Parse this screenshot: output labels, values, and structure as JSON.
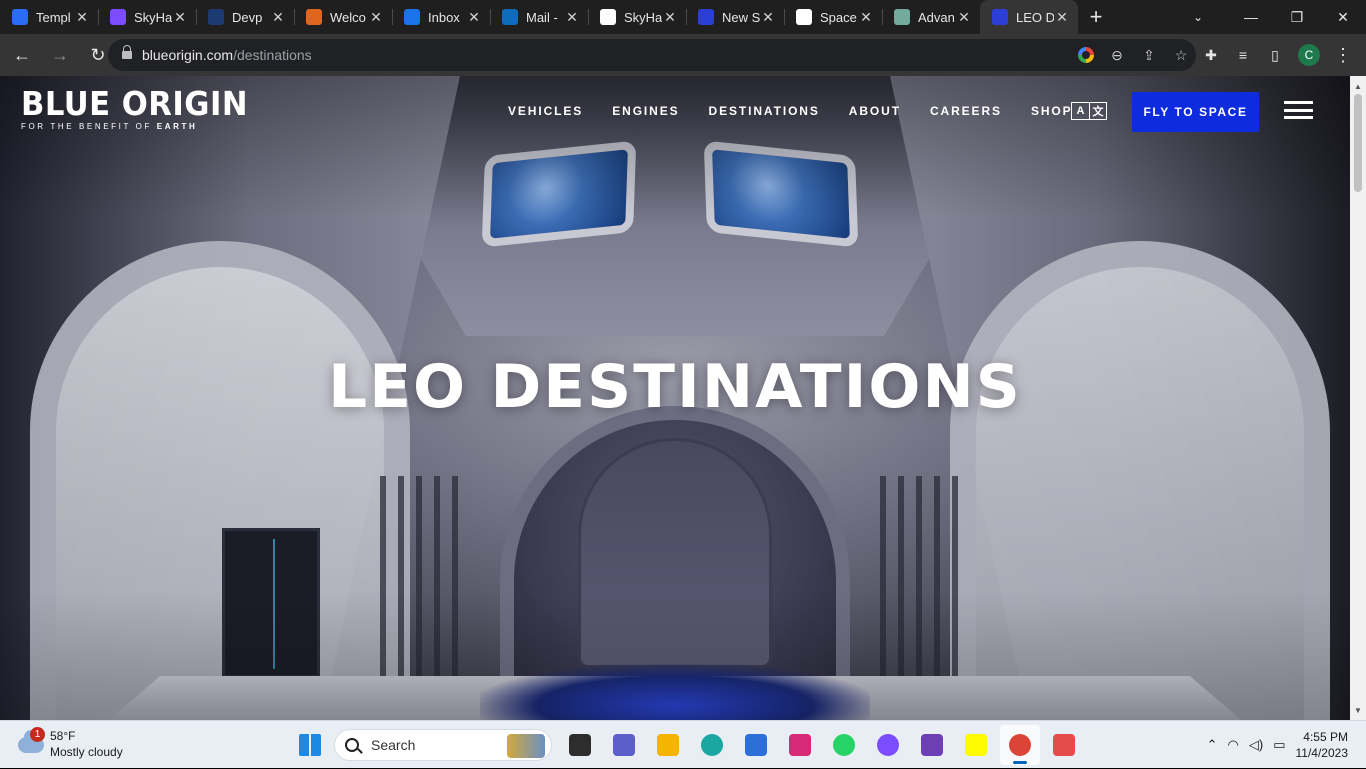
{
  "browser": {
    "tabs": [
      {
        "title": "Templ",
        "icon": "c-logo-icon",
        "color": "#2b6cf6"
      },
      {
        "title": "SkyHa",
        "icon": "shield-logo-icon",
        "color": "#7c4dff"
      },
      {
        "title": "Devp",
        "icon": "d-logo-icon",
        "color": "#1d3b73"
      },
      {
        "title": "Welco",
        "icon": "sunrise-icon",
        "color": "#e0651d"
      },
      {
        "title": "Inbox",
        "icon": "gear-logo-icon",
        "color": "#1a73e8"
      },
      {
        "title": "Mail -",
        "icon": "outlook-icon",
        "color": "#0f6cbd"
      },
      {
        "title": "SkyHa",
        "icon": "page-icon",
        "color": "#ffffff"
      },
      {
        "title": "New S",
        "icon": "feather-icon",
        "color": "#2b3fd6"
      },
      {
        "title": "Space",
        "icon": "x-logo-icon",
        "color": "#ffffff"
      },
      {
        "title": "Advan",
        "icon": "openai-icon",
        "color": "#74aa9c"
      },
      {
        "title": "LEO D",
        "icon": "feather-icon",
        "color": "#2b3fd6",
        "active": true
      }
    ],
    "url_host": "blueorigin.com",
    "url_path": "/destinations"
  },
  "site": {
    "logo": "BLUE ORIGIN",
    "tagline_prefix": "FOR THE BENEFIT OF ",
    "tagline_bold": "EARTH",
    "nav": [
      "VEHICLES",
      "ENGINES",
      "DESTINATIONS",
      "ABOUT",
      "CAREERS",
      "SHOP"
    ],
    "lang_a": "A",
    "lang_b": "文",
    "cta": "FLY TO SPACE",
    "hero_title": "LEO DESTINATIONS"
  },
  "taskbar": {
    "weather_badge": "1",
    "temp": "58°F",
    "condition": "Mostly cloudy",
    "search": "Search",
    "time": "4:55 PM",
    "date": "11/4/2023",
    "apps": [
      {
        "name": "start-icon",
        "color": "#1e88e5"
      },
      {
        "name": "file-explorer-dark-icon",
        "color": "#2d2d2d"
      },
      {
        "name": "teams-icon",
        "color": "#5b5fc7"
      },
      {
        "name": "folder-icon",
        "color": "#f4b400"
      },
      {
        "name": "edge-icon",
        "color": "#1ba7a1"
      },
      {
        "name": "store-icon",
        "color": "#2d6fd8"
      },
      {
        "name": "instagram-icon",
        "color": "#d62976"
      },
      {
        "name": "whatsapp-icon",
        "color": "#25d366"
      },
      {
        "name": "messenger-icon",
        "color": "#7b4dff"
      },
      {
        "name": "visual-studio-icon",
        "color": "#6c3fb5"
      },
      {
        "name": "snapchat-icon",
        "color": "#fffc00"
      },
      {
        "name": "chrome-icon",
        "color": "#db4437",
        "active": true
      },
      {
        "name": "snipping-tool-icon",
        "color": "#e54b4b"
      }
    ]
  }
}
